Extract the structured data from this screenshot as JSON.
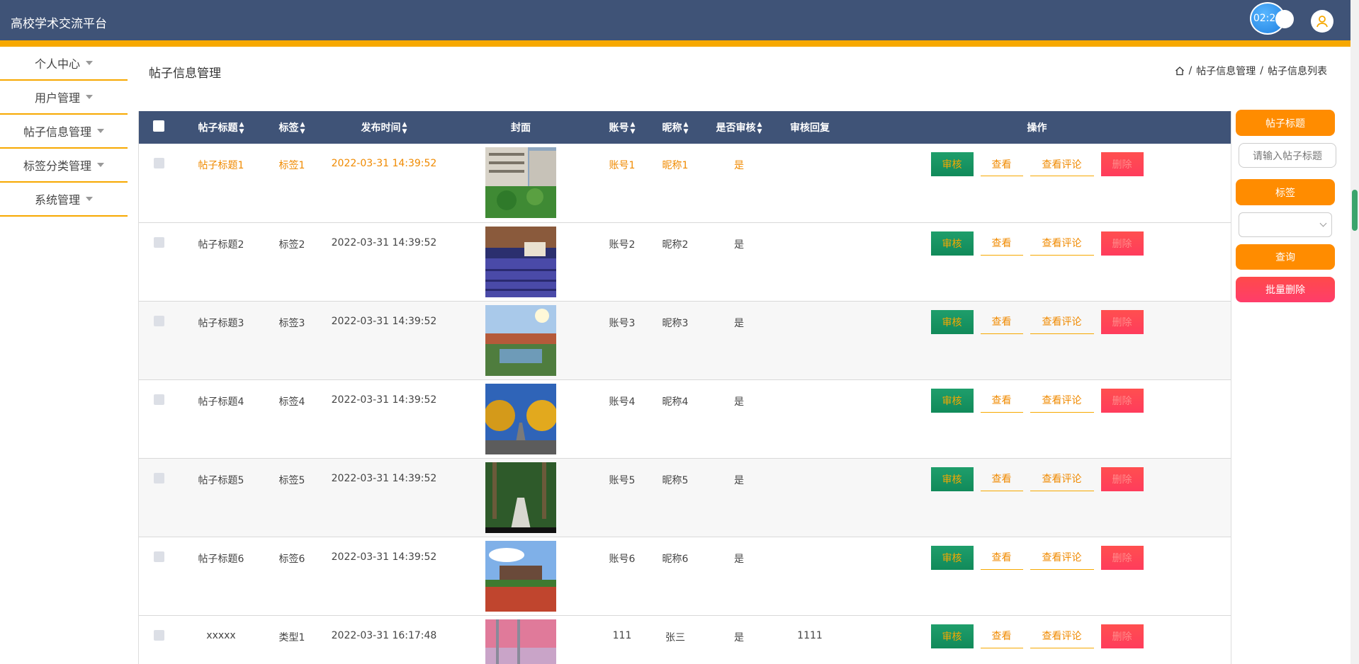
{
  "header": {
    "title": "高校学术交流平台",
    "clock": "02:20"
  },
  "sidebar": {
    "items": [
      {
        "label": "个人中心"
      },
      {
        "label": "用户管理"
      },
      {
        "label": "帖子信息管理"
      },
      {
        "label": "标签分类管理"
      },
      {
        "label": "系统管理"
      }
    ]
  },
  "page": {
    "title": "帖子信息管理",
    "breadcrumb": [
      "帖子信息管理",
      "帖子信息列表"
    ],
    "breadcrumb_sep": "/"
  },
  "table": {
    "columns": [
      "帖子标题",
      "标签",
      "发布时间",
      "封面",
      "账号",
      "昵称",
      "是否审核",
      "审核回复",
      "操作"
    ],
    "actions": {
      "review": "审核",
      "view": "查看",
      "comments": "查看评论",
      "delete": "删除"
    },
    "rows": [
      {
        "title": "帖子标题1",
        "tag": "标签1",
        "time": "2022-03-31 14:39:52",
        "account": "账号1",
        "nickname": "昵称1",
        "approved": "是",
        "reply": ""
      },
      {
        "title": "帖子标题2",
        "tag": "标签2",
        "time": "2022-03-31 14:39:52",
        "account": "账号2",
        "nickname": "昵称2",
        "approved": "是",
        "reply": ""
      },
      {
        "title": "帖子标题3",
        "tag": "标签3",
        "time": "2022-03-31 14:39:52",
        "account": "账号3",
        "nickname": "昵称3",
        "approved": "是",
        "reply": ""
      },
      {
        "title": "帖子标题4",
        "tag": "标签4",
        "time": "2022-03-31 14:39:52",
        "account": "账号4",
        "nickname": "昵称4",
        "approved": "是",
        "reply": ""
      },
      {
        "title": "帖子标题5",
        "tag": "标签5",
        "time": "2022-03-31 14:39:52",
        "account": "账号5",
        "nickname": "昵称5",
        "approved": "是",
        "reply": ""
      },
      {
        "title": "帖子标题6",
        "tag": "标签6",
        "time": "2022-03-31 14:39:52",
        "account": "账号6",
        "nickname": "昵称6",
        "approved": "是",
        "reply": ""
      },
      {
        "title": "xxxxx",
        "tag": "类型1",
        "time": "2022-03-31 16:17:48",
        "account": "111",
        "nickname": "张三",
        "approved": "是",
        "reply": "1111"
      }
    ]
  },
  "search": {
    "title_label": "帖子标题",
    "title_placeholder": "请输入帖子标题",
    "tag_label": "标签",
    "tag_value": "",
    "query_label": "查询",
    "batch_delete_label": "批量删除"
  },
  "colors": {
    "header": "#3f5377",
    "accent": "#f7a800",
    "review": "#118a5a",
    "danger": "#ff3c5c"
  }
}
